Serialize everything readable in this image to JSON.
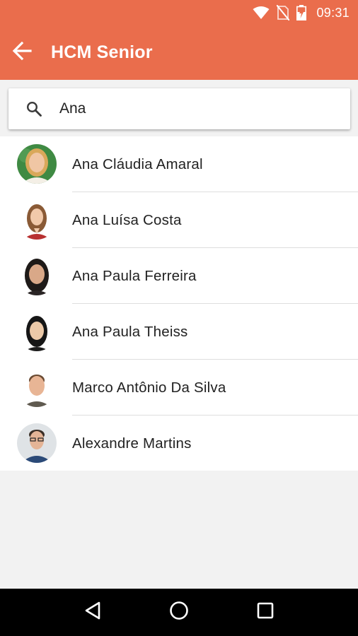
{
  "status_bar": {
    "time": "09:31",
    "icons": [
      "wifi-icon",
      "no-sim-icon",
      "battery-charging-icon"
    ]
  },
  "toolbar": {
    "back_icon": "arrow-back-icon",
    "title": "HCM Senior"
  },
  "search": {
    "icon": "search-icon",
    "value": "Ana"
  },
  "people": [
    {
      "name": "Ana Cláudia Amaral",
      "avatar": "avatar-photo"
    },
    {
      "name": "Ana Luísa Costa",
      "avatar": "avatar-photo"
    },
    {
      "name": "Ana Paula Ferreira",
      "avatar": "avatar-photo"
    },
    {
      "name": "Ana Paula Theiss",
      "avatar": "avatar-photo"
    },
    {
      "name": "Marco Antônio Da Silva",
      "avatar": "avatar-photo"
    },
    {
      "name": "Alexandre Martins",
      "avatar": "avatar-photo"
    }
  ],
  "nav_bar": {
    "buttons": [
      "back-triangle-icon",
      "home-circle-icon",
      "recents-square-icon"
    ]
  },
  "colors": {
    "primary": "#ea6d4c",
    "background": "#f2f2f2",
    "nav_bar": "#000000"
  }
}
